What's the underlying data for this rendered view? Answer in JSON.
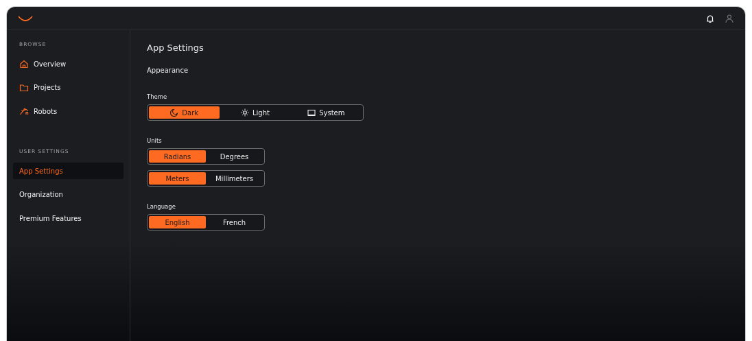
{
  "sidebar": {
    "sections": [
      {
        "heading": "BROWSE",
        "items": [
          {
            "label": "Overview",
            "selected": false
          },
          {
            "label": "Projects",
            "selected": false
          },
          {
            "label": "Robots",
            "selected": false
          }
        ]
      },
      {
        "heading": "USER SETTINGS",
        "items": [
          {
            "label": "App Settings",
            "selected": true
          },
          {
            "label": "Organization",
            "selected": false
          },
          {
            "label": "Premium Features",
            "selected": false
          }
        ]
      }
    ]
  },
  "page": {
    "title": "App Settings",
    "section": "Appearance",
    "groups": [
      {
        "label": "Theme",
        "controls": [
          {
            "options": [
              {
                "label": "Dark",
                "selected": true
              },
              {
                "label": "Light",
                "selected": false
              },
              {
                "label": "System",
                "selected": false
              }
            ]
          }
        ]
      },
      {
        "label": "Units",
        "controls": [
          {
            "options": [
              {
                "label": "Radians",
                "selected": true
              },
              {
                "label": "Degrees",
                "selected": false
              }
            ]
          },
          {
            "options": [
              {
                "label": "Meters",
                "selected": true
              },
              {
                "label": "Millimeters",
                "selected": false
              }
            ]
          }
        ]
      },
      {
        "label": "Language",
        "controls": [
          {
            "options": [
              {
                "label": "English",
                "selected": true
              },
              {
                "label": "French",
                "selected": false
              }
            ]
          }
        ]
      }
    ]
  }
}
